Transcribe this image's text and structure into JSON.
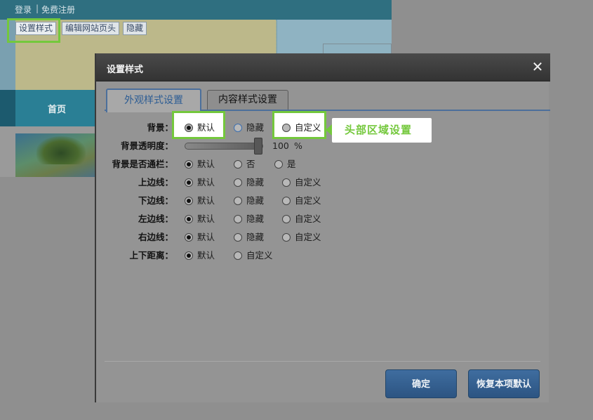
{
  "site": {
    "top_links": {
      "login": "登录",
      "separator": "|",
      "register": "免费注册"
    },
    "toolbar": {
      "set_style": "设置样式",
      "edit_header": "编辑网站页头",
      "hide": "隐藏"
    },
    "nav": {
      "home": "首页"
    }
  },
  "dialog": {
    "title": "设置样式",
    "close_glyph": "✕",
    "tabs": [
      {
        "label": "外观样式设置",
        "active": true
      },
      {
        "label": "内容样式设置",
        "active": false
      }
    ],
    "callout": "头部区域设置",
    "rows": {
      "background": {
        "label": "背景：",
        "options": [
          "默认",
          "隐藏",
          "自定义"
        ],
        "selected": 0
      },
      "transparency": {
        "label": "背景透明度：",
        "value": "100",
        "unit": "%",
        "level_percent": 100
      },
      "full_width": {
        "label": "背景是否通栏：",
        "options": [
          "默认",
          "否",
          "是"
        ],
        "selected": 0
      },
      "top_border": {
        "label": "上边线：",
        "options": [
          "默认",
          "隐藏",
          "自定义"
        ],
        "selected": 0
      },
      "bottom_border": {
        "label": "下边线：",
        "options": [
          "默认",
          "隐藏",
          "自定义"
        ],
        "selected": 0
      },
      "left_border": {
        "label": "左边线：",
        "options": [
          "默认",
          "隐藏",
          "自定义"
        ],
        "selected": 0
      },
      "right_border": {
        "label": "右边线：",
        "options": [
          "默认",
          "隐藏",
          "自定义"
        ],
        "selected": 0
      },
      "spacing": {
        "label": "上下距离：",
        "options": [
          "默认",
          "自定义"
        ],
        "selected": 0
      }
    },
    "buttons": {
      "ok": "确定",
      "restore": "恢复本项默认"
    }
  },
  "colors": {
    "highlight": "#74c83c",
    "button_blue": "#3a6796",
    "tab_accent": "#4c6f9b"
  }
}
